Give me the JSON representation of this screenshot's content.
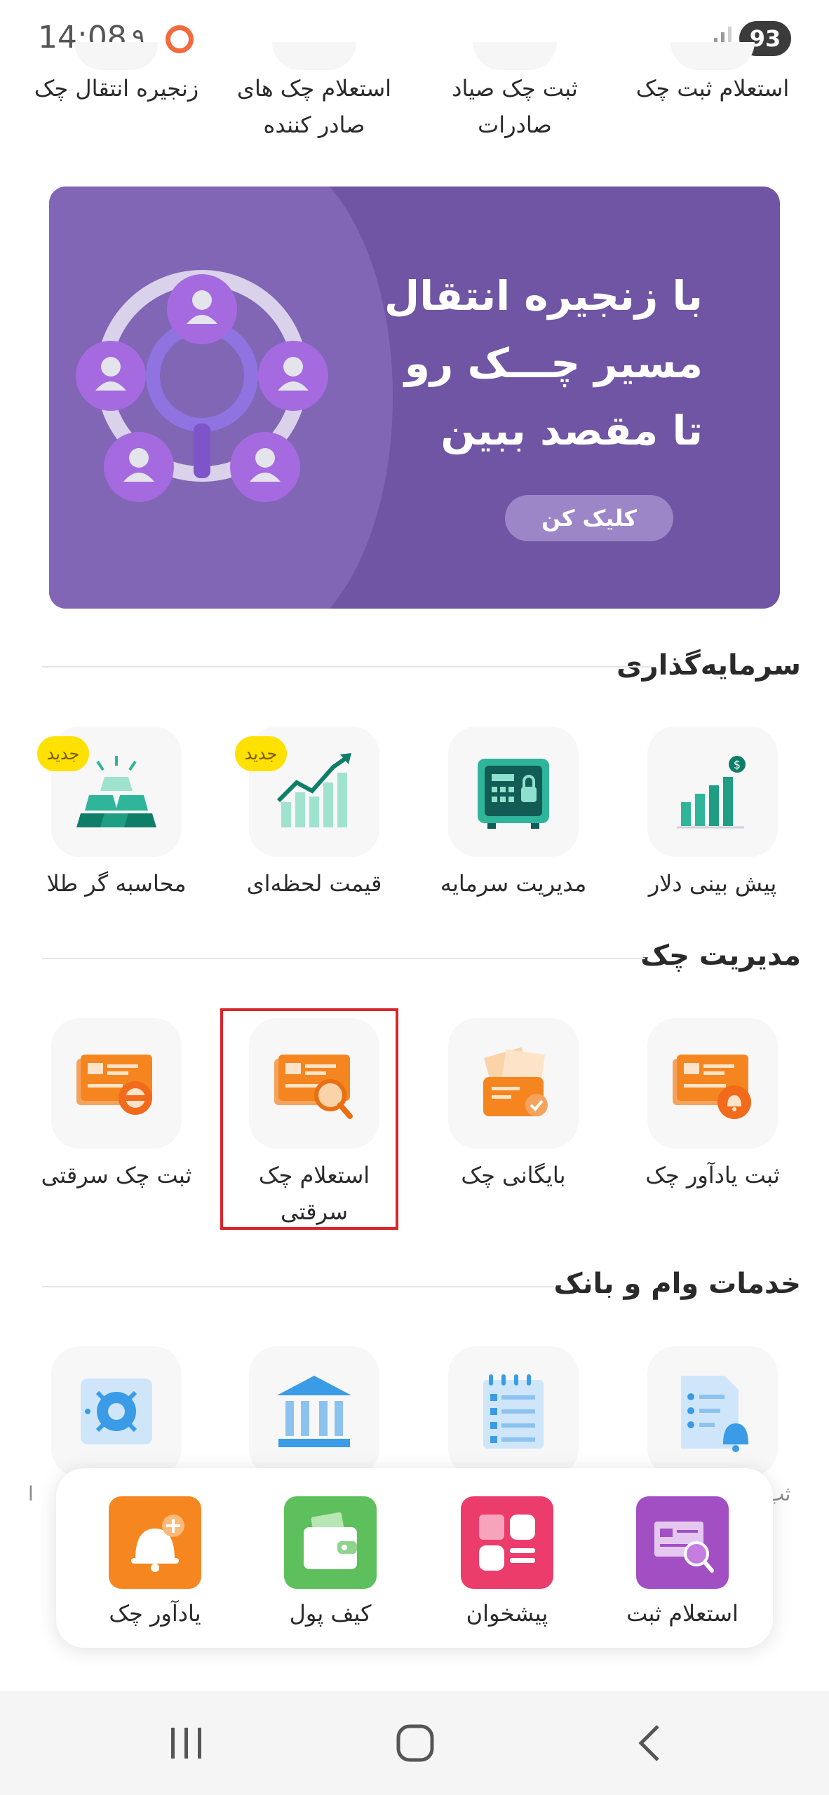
{
  "status": {
    "time": "14:08",
    "extra": "۹",
    "battery": "93"
  },
  "top_row": [
    "استعلام ثبت چک",
    "ثبت چک صیاد صادرات",
    "استعلام چک های صادر کننده",
    "زنجیره انتقال چک"
  ],
  "banner": {
    "line1": "با زنجیره انتقال",
    "line2": "مسیر چـــک رو",
    "line3": "تا مقصد ببین",
    "button": "کلیک کن"
  },
  "sections": {
    "investment": {
      "title": "سرمایه‌گذاری",
      "items": [
        {
          "label": "پیش بینی دلار",
          "icon": "chart-dollar-icon"
        },
        {
          "label": "مدیریت سرمایه",
          "icon": "safe-icon"
        },
        {
          "label": "قیمت لحظه‌ای",
          "icon": "trend-chart-icon",
          "badge": "جدید"
        },
        {
          "label": "محاسبه گر طلا",
          "icon": "gold-bars-icon",
          "badge": "جدید"
        }
      ]
    },
    "check_management": {
      "title": "مدیریت چک",
      "items": [
        {
          "label": "ثبت یادآور چک",
          "icon": "check-bell-icon"
        },
        {
          "label": "بایگانی چک",
          "icon": "check-archive-icon"
        },
        {
          "label": "استعلام چک سرقتی",
          "icon": "check-search-icon"
        },
        {
          "label": "ثبت چک سرقتی",
          "icon": "check-stolen-icon"
        }
      ]
    },
    "loan_bank": {
      "title": "خدمات وام و بانک",
      "partial_left": "ا",
      "partial_right": "ثب"
    }
  },
  "dock": [
    {
      "label": "استعلام ثبت",
      "icon": "inquiry-icon",
      "color": "#a24fc4"
    },
    {
      "label": "پیشخوان",
      "icon": "dashboard-icon",
      "color": "#ec3c6c"
    },
    {
      "label": "کیف پول",
      "icon": "wallet-icon",
      "color": "#5dc05d"
    },
    {
      "label": "یادآور چک",
      "icon": "bell-add-icon",
      "color": "#f6861f"
    }
  ]
}
